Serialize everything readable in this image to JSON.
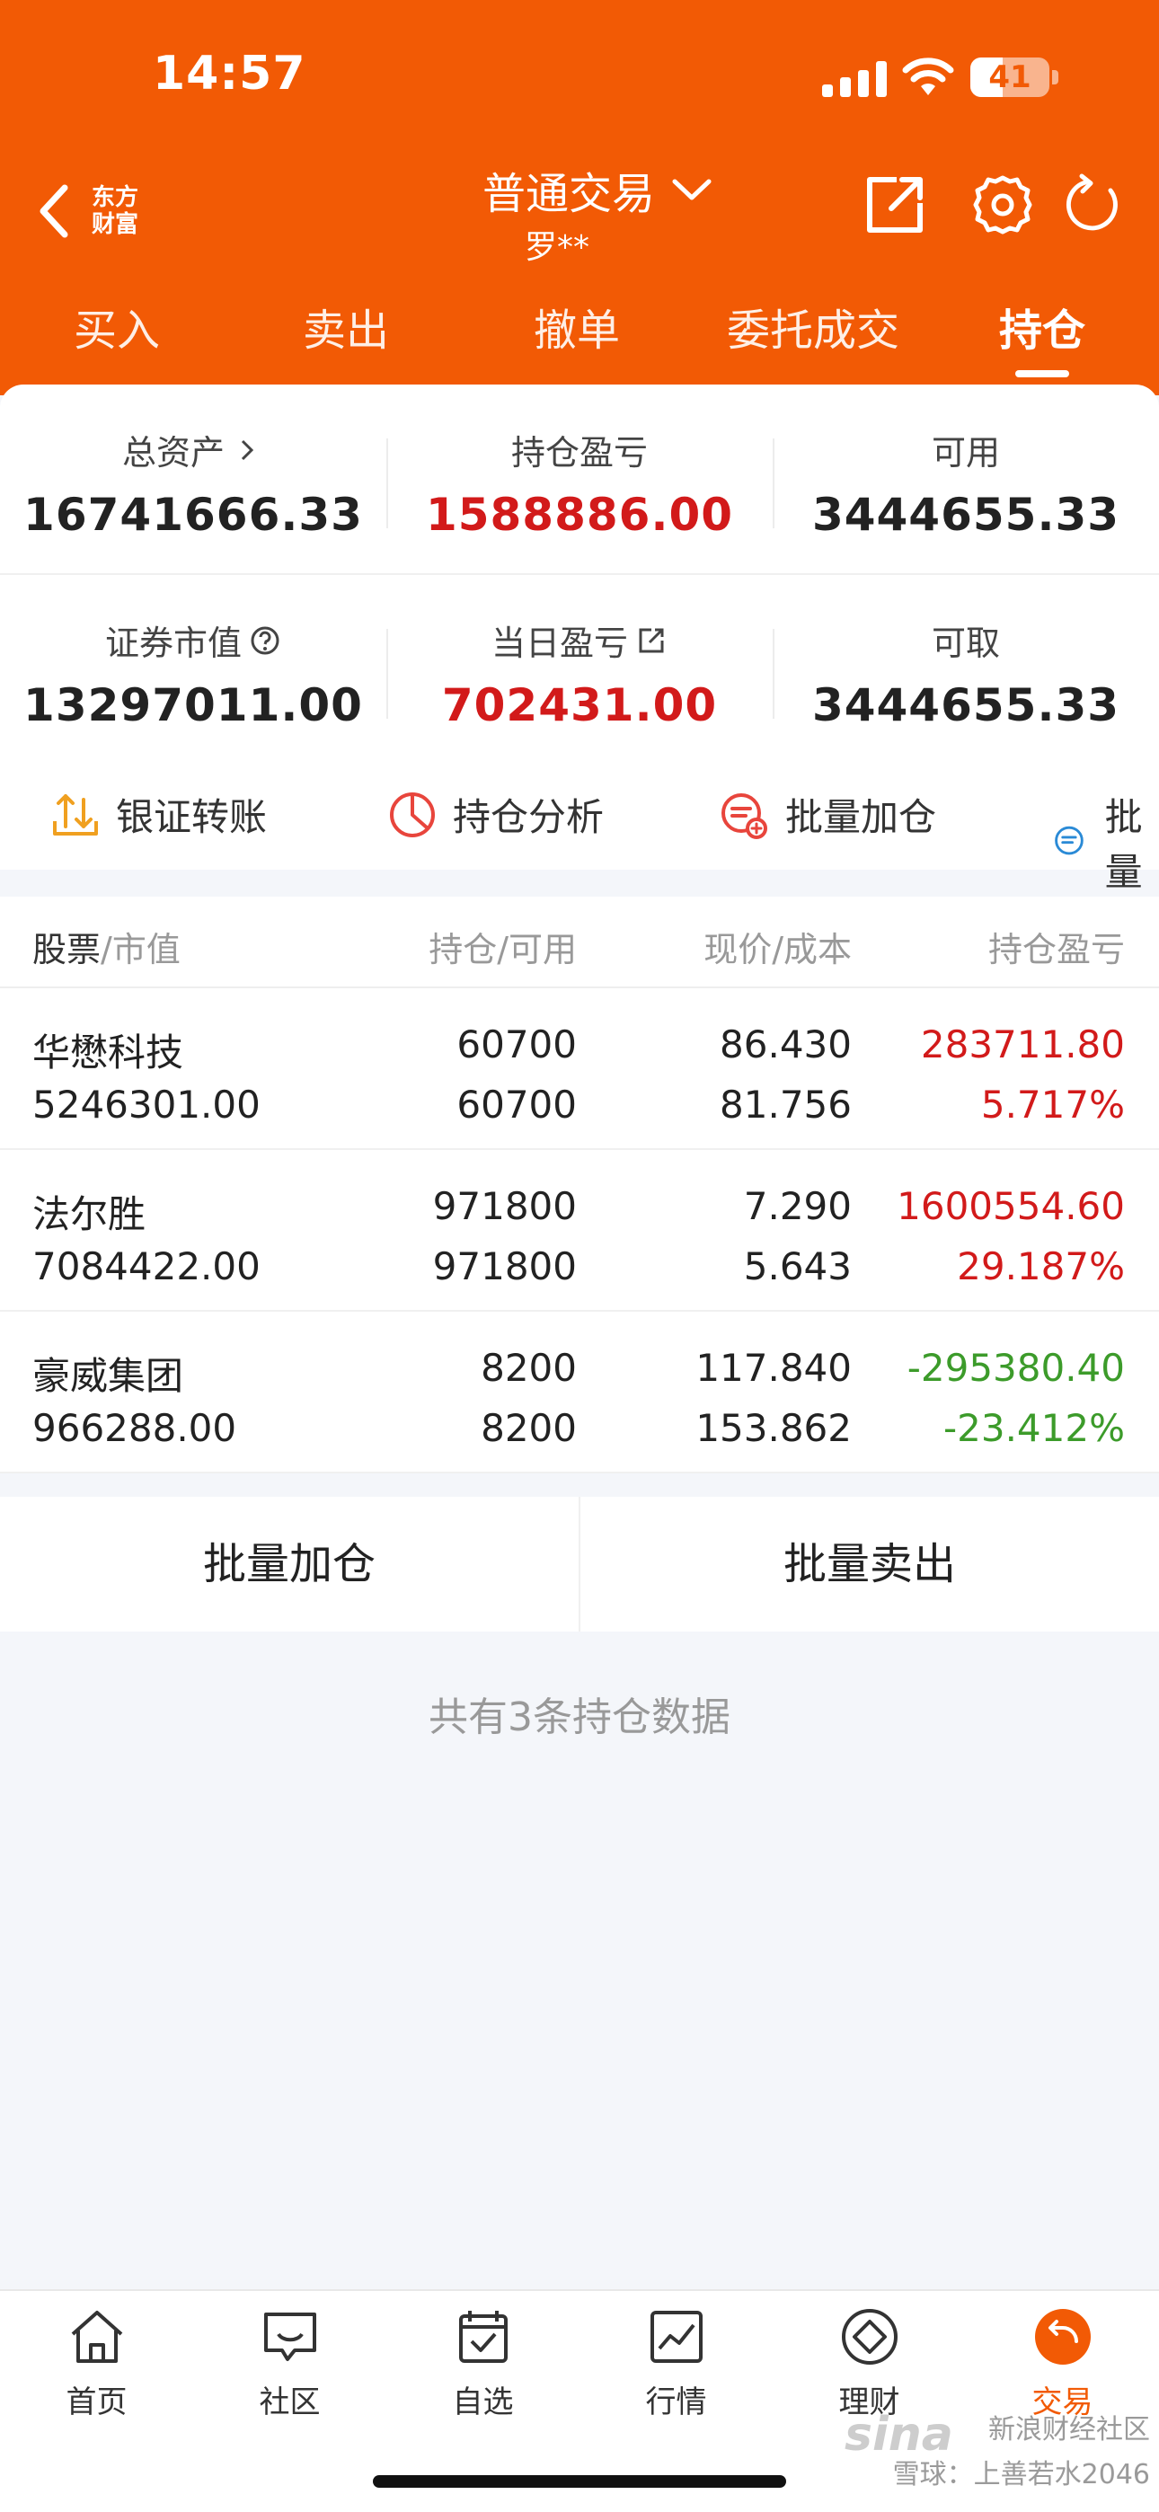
{
  "status_bar": {
    "time": "14:57",
    "battery": "41",
    "battery_level_percent": 41
  },
  "header": {
    "brand": "东方\n财富",
    "title": "普通交易",
    "account": "罗**"
  },
  "tabs": [
    "买入",
    "卖出",
    "撤单",
    "委托成交",
    "持仓"
  ],
  "active_tab": "持仓",
  "summary": {
    "total_assets_label": "总资产",
    "total_assets": "16741666.33",
    "position_pl_label": "持仓盈亏",
    "position_pl": "1588886.00",
    "available_label": "可用",
    "available": "3444655.33",
    "market_value_label": "证券市值",
    "market_value": "13297011.00",
    "daily_pl_label": "当日盈亏",
    "daily_pl": "702431.00",
    "withdrawable_label": "可取",
    "withdrawable": "3444655.33"
  },
  "actions": [
    "银证转账",
    "持仓分析",
    "批量加仓",
    "批量"
  ],
  "table": {
    "headers": {
      "stock": "股票",
      "market_value": "/市值",
      "position": "持仓/可用",
      "price": "现价/成本",
      "pl": "持仓盈亏"
    },
    "rows": [
      {
        "name": "华懋科技",
        "value": "5246301.00",
        "position": "60700",
        "available": "60700",
        "price": "86.430",
        "cost": "81.756",
        "pl": "283711.80",
        "pl_pct": "5.717%",
        "trend": "up"
      },
      {
        "name": "法尔胜",
        "value": "7084422.00",
        "position": "971800",
        "available": "971800",
        "price": "7.290",
        "cost": "5.643",
        "pl": "1600554.60",
        "pl_pct": "29.187%",
        "trend": "up"
      },
      {
        "name": "豪威集团",
        "value": "966288.00",
        "position": "8200",
        "available": "8200",
        "price": "117.840",
        "cost": "153.862",
        "pl": "-295380.40",
        "pl_pct": "-23.412%",
        "trend": "down"
      }
    ]
  },
  "buttons": {
    "batch_add": "批量加仓",
    "batch_sell": "批量卖出"
  },
  "footer_text": "共有3条持仓数据",
  "bottom_nav": [
    "首页",
    "社区",
    "自选",
    "行情",
    "理财",
    "交易"
  ],
  "active_nav": "交易",
  "watermark": {
    "line1": "新浪财经社区",
    "line2": "雪球：上善若水2046",
    "logo": "sina"
  },
  "colors": {
    "brand_orange": "#f25a05",
    "up_red": "#d21a1a",
    "down_green": "#3c9b2a"
  }
}
